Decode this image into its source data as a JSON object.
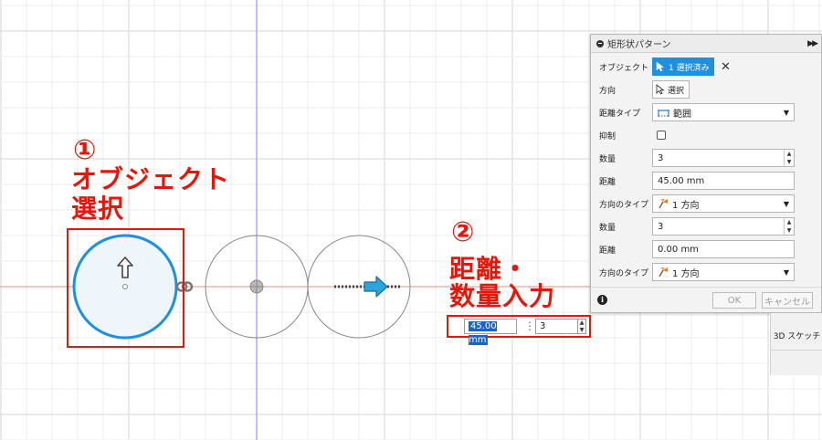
{
  "annotations": {
    "step1": {
      "number": "①",
      "line1": "オブジェクト",
      "line2": "選択"
    },
    "step2": {
      "number": "②",
      "line1": "距離・",
      "line2": "数量入力"
    }
  },
  "canvas_inputs": {
    "distance_value": "45.00 mm",
    "quantity_value": "3"
  },
  "dialog": {
    "title": "矩形状パターン",
    "rows": {
      "object": {
        "label": "オブジェクト",
        "button": "1 選択済み"
      },
      "direction": {
        "label": "方向",
        "button": "選択"
      },
      "distance_type": {
        "label": "距離タイプ",
        "value": "範囲"
      },
      "suppress": {
        "label": "抑制",
        "checked": false
      },
      "quantity1": {
        "label": "数量",
        "value": "3"
      },
      "distance1": {
        "label": "距離",
        "value": "45.00 mm"
      },
      "direction_type1": {
        "label": "方向のタイプ",
        "value": "1 方向"
      },
      "quantity2": {
        "label": "数量",
        "value": "3"
      },
      "distance2": {
        "label": "距離",
        "value": "0.00 mm"
      },
      "direction_type2": {
        "label": "方向のタイプ",
        "value": "1 方向"
      }
    },
    "footer": {
      "ok": "OK",
      "cancel": "キャンセル"
    }
  },
  "side_panel": {
    "label": "3D スケッチ"
  },
  "colors": {
    "annotation_red": "#e8150b",
    "selection_blue": "#1f8fe0",
    "arrow_blue": "#2aa6dc",
    "axis_red": "#f07070",
    "axis_blue": "#6a6aff"
  }
}
